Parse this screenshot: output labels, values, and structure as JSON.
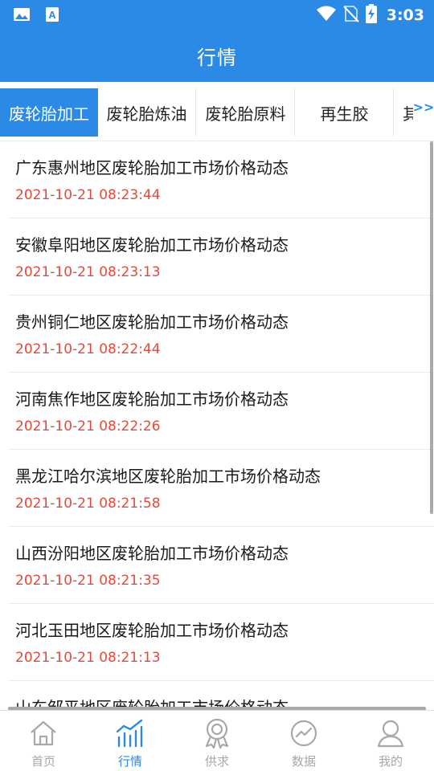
{
  "status_bar": {
    "time": "3:03",
    "left_icons": [
      "image-icon",
      "font-app-icon"
    ],
    "right_icons": [
      "wifi-icon",
      "no-sim-icon",
      "battery-charging-icon"
    ]
  },
  "header": {
    "title": "行情"
  },
  "tabs": [
    {
      "label": "废轮胎加工",
      "active": true
    },
    {
      "label": "废轮胎炼油",
      "active": false
    },
    {
      "label": "废轮胎原料",
      "active": false
    },
    {
      "label": "再生胶",
      "active": false
    },
    {
      "label": "其",
      "active": false
    }
  ],
  "tabs_more_label": ">>",
  "list": [
    {
      "title": "广东惠州地区废轮胎加工市场价格动态",
      "time": "2021-10-21 08:23:44"
    },
    {
      "title": "安徽阜阳地区废轮胎加工市场价格动态",
      "time": "2021-10-21 08:23:13"
    },
    {
      "title": "贵州铜仁地区废轮胎加工市场价格动态",
      "time": "2021-10-21 08:22:44"
    },
    {
      "title": "河南焦作地区废轮胎加工市场价格动态",
      "time": "2021-10-21 08:22:26"
    },
    {
      "title": "黑龙江哈尔滨地区废轮胎加工市场价格动态",
      "time": "2021-10-21 08:21:58"
    },
    {
      "title": "山西汾阳地区废轮胎加工市场价格动态",
      "time": "2021-10-21 08:21:35"
    },
    {
      "title": "河北玉田地区废轮胎加工市场价格动态",
      "time": "2021-10-21 08:21:13"
    },
    {
      "title": "山东邹平地区废轮胎加工市场价格动态",
      "time": ""
    }
  ],
  "bottom_nav": [
    {
      "label": "首页",
      "icon": "home-icon",
      "active": false
    },
    {
      "label": "行情",
      "icon": "market-chart-icon",
      "active": true
    },
    {
      "label": "供求",
      "icon": "supply-badge-icon",
      "active": false
    },
    {
      "label": "数据",
      "icon": "data-trend-icon",
      "active": false
    },
    {
      "label": "我的",
      "icon": "user-icon",
      "active": false
    }
  ],
  "colors": {
    "primary": "#2b8ae6",
    "time_text": "#e24a3b",
    "nav_inactive": "#a8a8a8"
  }
}
